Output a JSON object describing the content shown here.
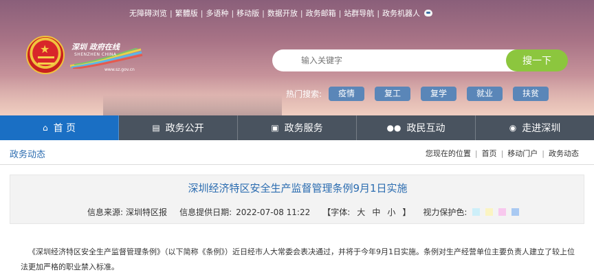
{
  "header": {
    "top_links": [
      "无障碍浏览",
      "繁體版",
      "多语种",
      "移动版",
      "数据开放",
      "政务邮箱",
      "站群导航",
      "政务机器人"
    ],
    "logo": {
      "cn": "深圳 政府在线",
      "en": "SHENZHEN CHINA",
      "url": "www.sz.gov.cn"
    },
    "search": {
      "placeholder": "输入关键字",
      "button": "搜一下"
    },
    "hot": {
      "label": "热门搜索:",
      "tags": [
        "疫情",
        "复工",
        "复学",
        "就业",
        "扶贫"
      ]
    }
  },
  "nav": {
    "items": [
      {
        "label": "首 页",
        "icon": "home-icon"
      },
      {
        "label": "政务公开",
        "icon": "news-icon"
      },
      {
        "label": "政务服务",
        "icon": "monitor-icon"
      },
      {
        "label": "政民互动",
        "icon": "people-icon"
      },
      {
        "label": "走进深圳",
        "icon": "info-icon"
      }
    ]
  },
  "crumbbar": {
    "title": "政务动态",
    "breadcrumb": [
      "您现在的位置",
      "首页",
      "移动门户",
      "政务动态"
    ]
  },
  "article": {
    "title": "深圳经济特区安全生产监督管理条例9月1日实施",
    "source_label": "信息来源:",
    "source": "深圳特区报",
    "date_label": "信息提供日期:",
    "date": "2022-07-08 11:22",
    "font_label": "【字体:",
    "font_sizes": [
      "大",
      "中",
      "小"
    ],
    "font_close": "】",
    "eye_label": "视力保护色:",
    "eye_colors": [
      "#cdeff9",
      "#fbf4c2",
      "#f8c8ee",
      "#a9c9f2"
    ],
    "body": "《深圳经济特区安全生产监督管理条例》（以下简称《条例》）近日经市人大常委会表决通过，并将于今年9月1日实施。条例对生产经营单位主要负责人建立了较上位法更加严格的职业禁入标准。"
  }
}
